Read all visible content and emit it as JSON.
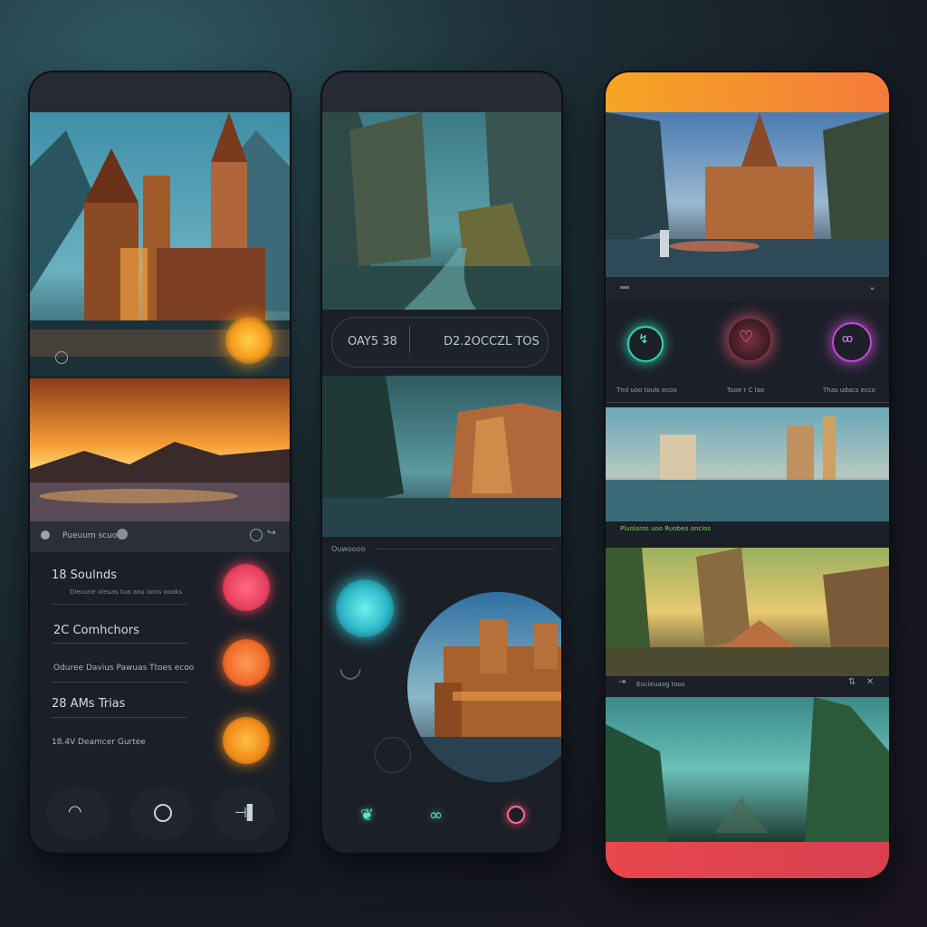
{
  "phone1": {
    "scene_caption": "Pueuum scuoo",
    "list": [
      {
        "title": "18 Soulnds",
        "subtitle": "Diecune oleuas tuo aou lanis ooaks"
      },
      {
        "title": "2C Comhchors",
        "subtitle": ""
      },
      {
        "title": "Oduree Davius Pawuas Ttoes ecoo",
        "subtitle": ""
      },
      {
        "title": "28 AMs Trias",
        "subtitle": ""
      },
      {
        "title": "18.4V Deamcer Gurtee",
        "subtitle": ""
      }
    ],
    "colors": {
      "pink": "#e8415f",
      "orange": "#f26b2a",
      "amber": "#f08a1a"
    }
  },
  "phone2": {
    "stat_left": "OAY5 38",
    "stat_right": "D2.2OCCZL TOS",
    "section_label": "Ouwoooo"
  },
  "phone3": {
    "row_labels": [
      "Tnd uoo touls ecoo",
      "Tuoe r C lao",
      "Thas udacs ecco"
    ],
    "caption2": "Pluolaros uoo Ruobeo oncios",
    "list_item": "Eucieuaog toos",
    "colors": {
      "teal": "#2fd6b5",
      "pink": "#ff5a7a",
      "purple": "#c64bd9",
      "gradient_top": "#f5a623",
      "gradient_bottom": "#e8474d"
    }
  }
}
